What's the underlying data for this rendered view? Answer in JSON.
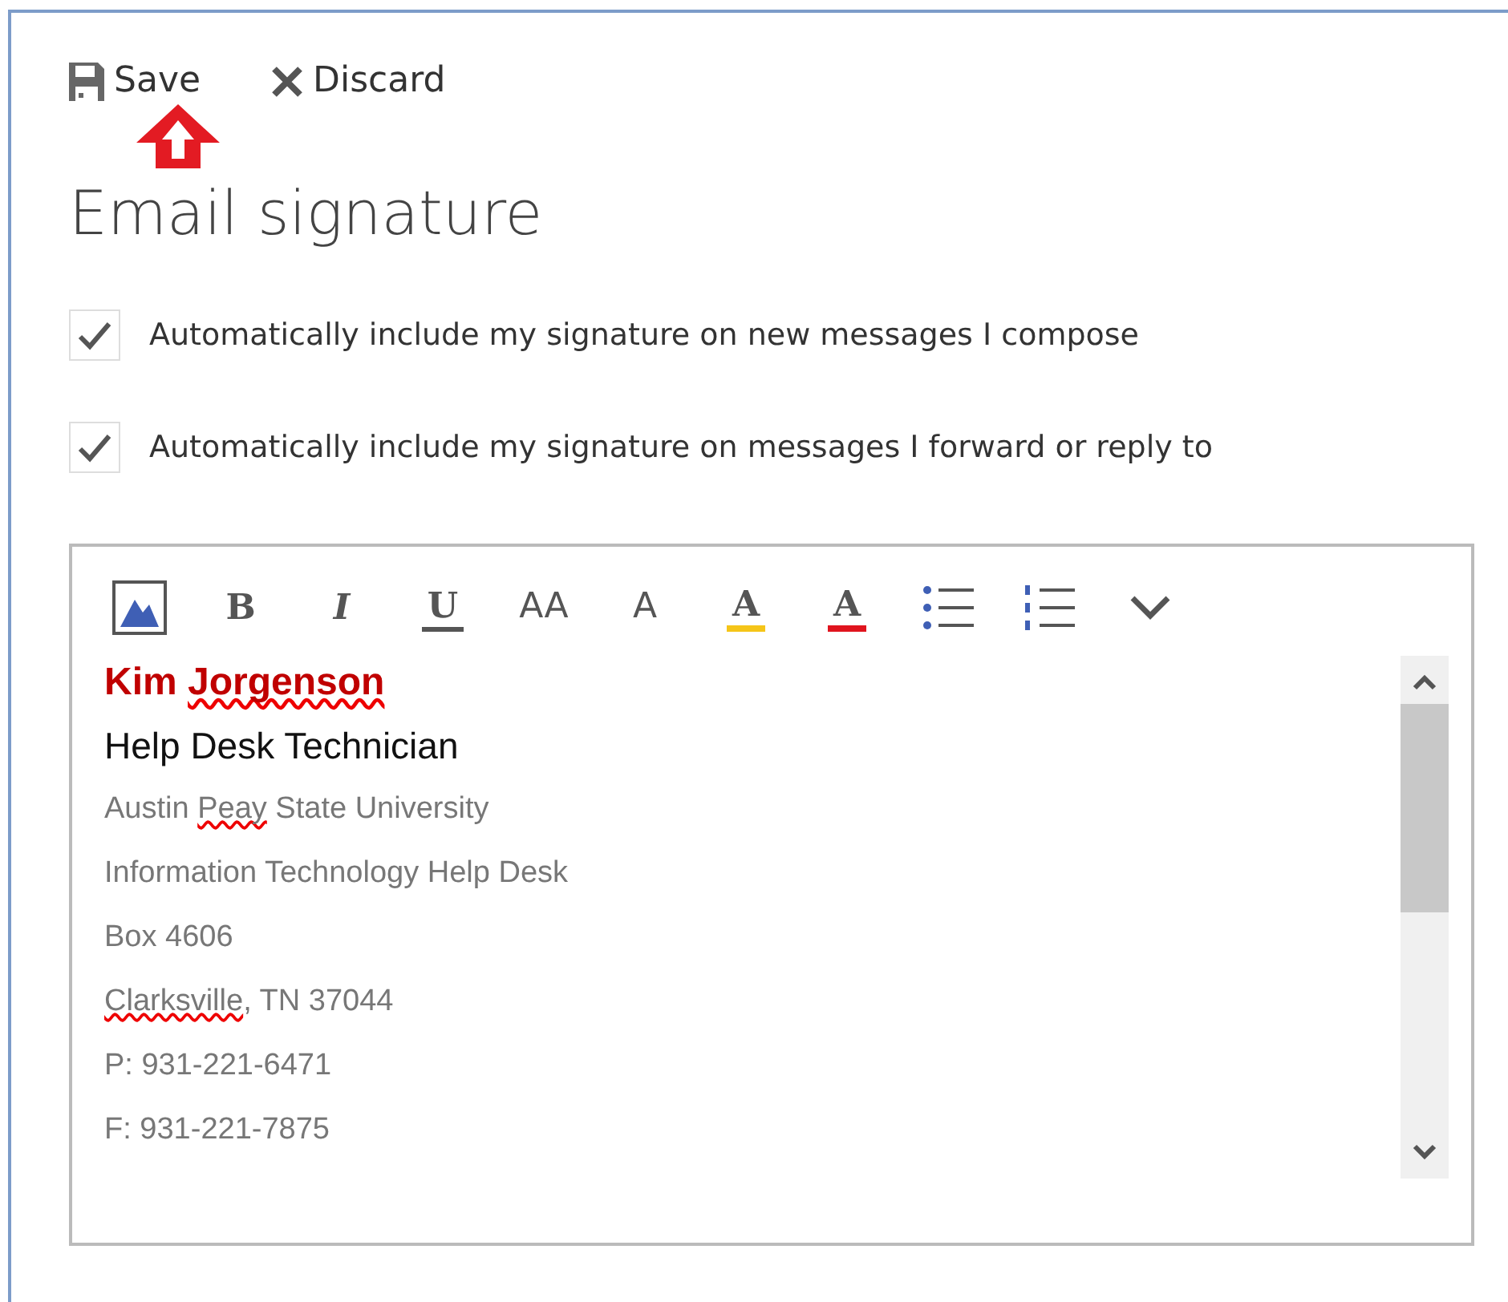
{
  "commands": [
    {
      "kind": "save",
      "label": "Save"
    },
    {
      "kind": "discard",
      "label": "Discard"
    }
  ],
  "title": "Email signature",
  "options": [
    {
      "label": "Automatically include my signature on new messages I compose",
      "checked": true
    },
    {
      "label": "Automatically include my signature on messages I forward or reply to",
      "checked": true
    }
  ],
  "toolbar": [
    {
      "kind": "picture"
    },
    {
      "kind": "bold",
      "label": "B"
    },
    {
      "kind": "italic",
      "label": "I"
    },
    {
      "kind": "underline",
      "label": "U"
    },
    {
      "kind": "font-size",
      "label": "AA"
    },
    {
      "kind": "grow",
      "label": "A"
    },
    {
      "kind": "highlight",
      "label": "A"
    },
    {
      "kind": "color",
      "label": "A"
    },
    {
      "kind": "bullets"
    },
    {
      "kind": "numbering"
    },
    {
      "kind": "more"
    }
  ],
  "signature": [
    {
      "kind": "name",
      "parts": [
        {
          "text": "Kim "
        },
        {
          "text": "Jorgenson",
          "misspelled": true
        }
      ]
    },
    {
      "kind": "title",
      "parts": [
        {
          "text": "Help Desk Technician"
        }
      ]
    },
    {
      "kind": "detail",
      "parts": [
        {
          "text": "Austin "
        },
        {
          "text": "Peay",
          "misspelled": true
        },
        {
          "text": " State University"
        }
      ]
    },
    {
      "kind": "detail",
      "parts": [
        {
          "text": "Information Technology Help Desk"
        }
      ]
    },
    {
      "kind": "detail",
      "parts": [
        {
          "text": "Box 4606"
        }
      ]
    },
    {
      "kind": "detail",
      "parts": [
        {
          "text": "Clarksville",
          "misspelled": true
        },
        {
          "text": ", TN 37044"
        }
      ]
    },
    {
      "kind": "detail",
      "parts": [
        {
          "text": "P: 931-221-6471"
        }
      ]
    },
    {
      "kind": "detail",
      "parts": [
        {
          "text": "F: 931-221-7875"
        }
      ]
    }
  ]
}
